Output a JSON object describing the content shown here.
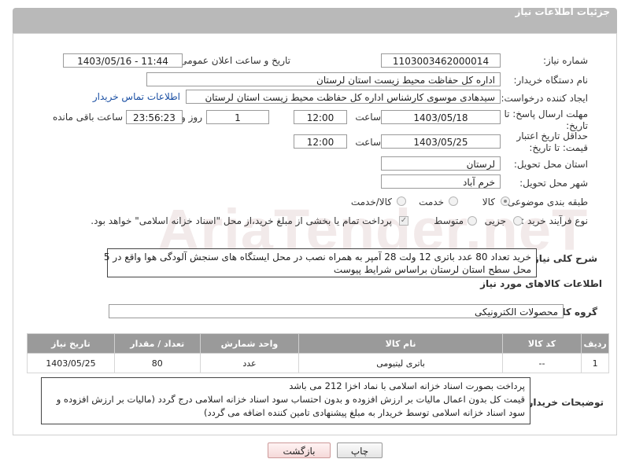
{
  "header": {
    "title": "جزئیات اطلاعات نیاز"
  },
  "watermark": {
    "text": "AriaTender.neT"
  },
  "fields": {
    "need_number_label": "شماره نیاز:",
    "need_number": "1103003462000014",
    "announce_label": "تاریخ و ساعت اعلان عمومی:",
    "announce_value": "1403/05/16 - 11:44",
    "buyer_label": "نام دستگاه خریدار:",
    "buyer_value": "اداره کل حفاظت محیط زیست استان لرستان",
    "creator_label": "ایجاد کننده درخواست:",
    "creator_value": "سیدهادی موسوی کارشناس اداره کل حفاظت محیط زیست استان لرستان",
    "contact_link": "اطلاعات تماس خریدار",
    "deadline_label": "مهلت ارسال پاسخ: تا تاریخ:",
    "deadline_date": "1403/05/18",
    "time_label": "ساعت",
    "deadline_time": "12:00",
    "days_value": "1",
    "day_and_label": "روز و",
    "remaining_time": "23:56:23",
    "remaining_label": "ساعت باقی مانده",
    "validity_label": "حداقل تاریخ اعتبار قیمت: تا تاریخ:",
    "validity_date": "1403/05/25",
    "validity_time": "12:00",
    "province_label": "استان محل تحویل:",
    "province_value": "لرستان",
    "city_label": "شهر محل تحویل:",
    "city_value": "خرم آباد",
    "category_label": "طبقه بندی موضوعی:",
    "category_options": [
      "کالا",
      "خدمت",
      "کالا/خدمت"
    ],
    "process_label": "نوع فرآیند خرید :",
    "process_options": [
      "جزیی",
      "متوسط"
    ],
    "process_note": "پرداخت تمام یا بخشی از مبلغ خرید،از محل \"اسناد خزانه اسلامی\" خواهد بود."
  },
  "description": {
    "label": "شرح کلی نیاز:",
    "line1": "خرید تعداد 80 عدد باتری 12 ولت 28 آمپر به همراه نصب در محل ایستگاه های سنجش آلودگی هوا واقع در 5",
    "line2": "محل سطح استان لرستان براساس شرایط پیوست"
  },
  "goods": {
    "section_title": "اطلاعات کالاهای مورد نیاز",
    "group_label": "گروه کالا:",
    "group_value": "محصولات الکترونیکی",
    "columns": [
      "ردیف",
      "کد کالا",
      "نام کالا",
      "واحد شمارش",
      "تعداد / مقدار",
      "تاریخ نیاز"
    ],
    "rows": [
      [
        "1",
        "--",
        "باتری لیتیومی",
        "عدد",
        "80",
        "1403/05/25"
      ]
    ]
  },
  "buyer_notes": {
    "label": "توضیحات خریدار:",
    "line1": "پرداخت بصورت اسناد خزانه اسلامی با نماد اخزا 212 می باشد",
    "line2": "قیمت کل بدون اعمال مالیات بر ارزش افزوده و بدون احتساب سود اسناد خزانه اسلامی درج گردد (مالیات بر ارزش افزوده و",
    "line3": "سود اسناد خزانه اسلامی توسط خریدار به مبلغ پیشنهادی تامین کننده اضافه می گردد)"
  },
  "buttons": {
    "print": "چاپ",
    "back": "بازگشت"
  }
}
